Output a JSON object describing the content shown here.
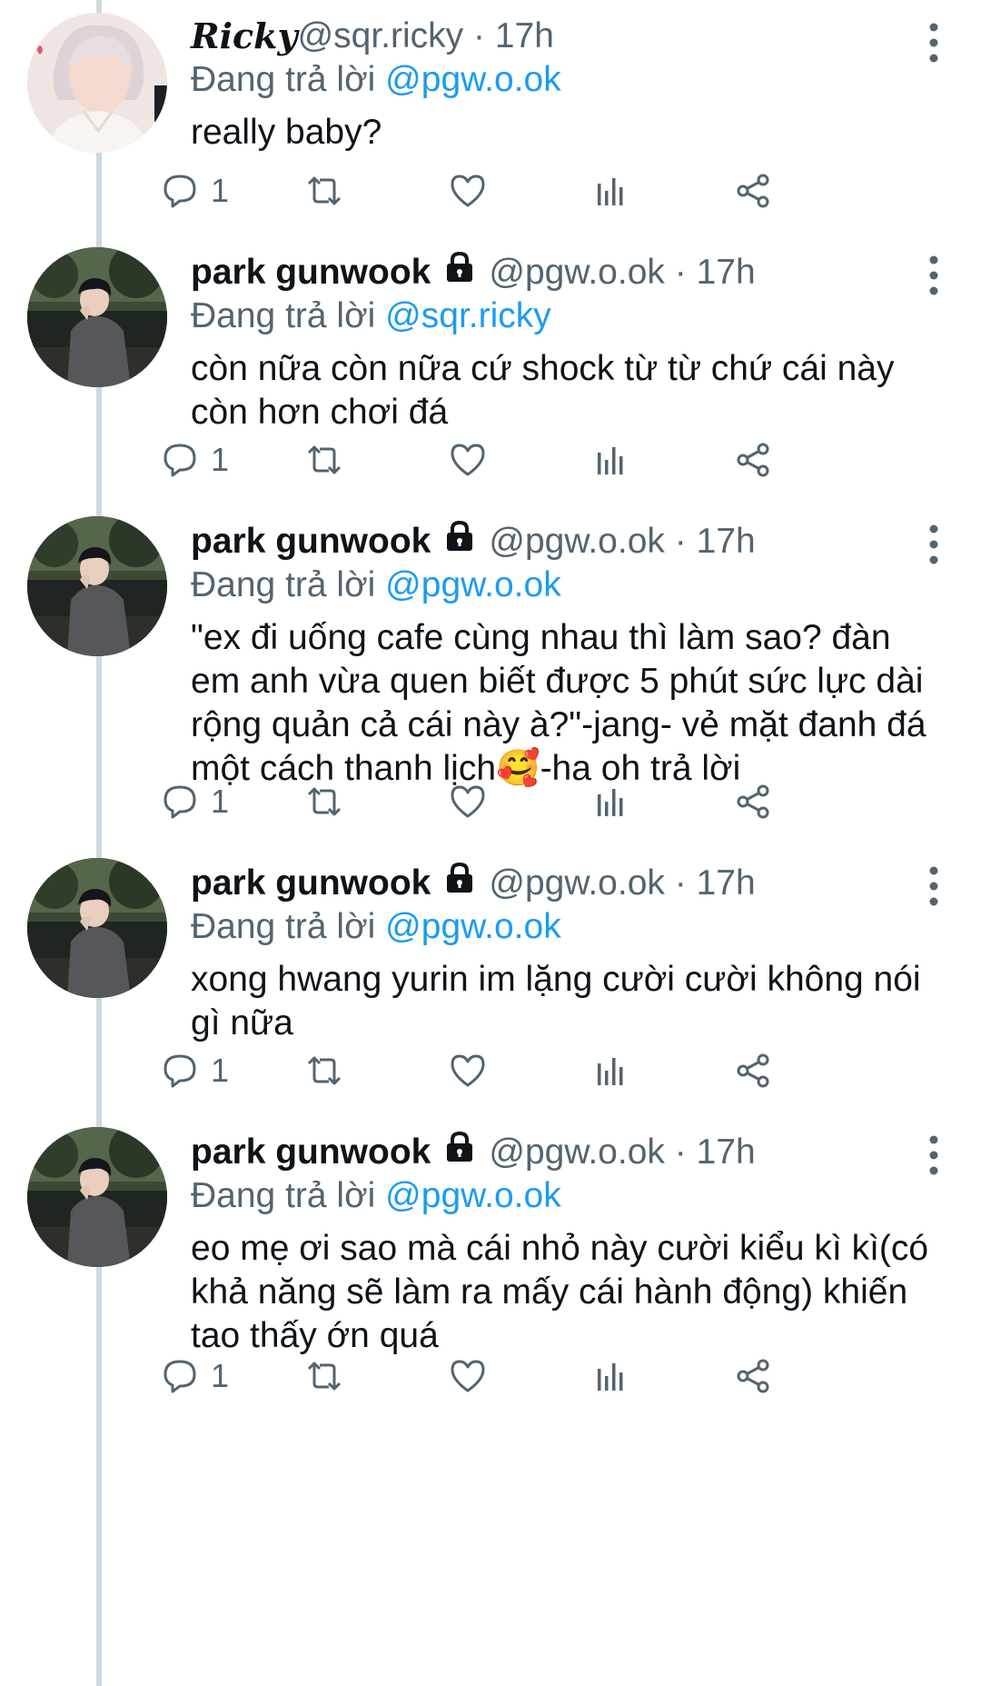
{
  "tweets": [
    {
      "display_name": "Ricky",
      "handle": "@sqr.ricky",
      "separator": " · ",
      "time": "17h",
      "locked": false,
      "reply_label": "Đang trả lời ",
      "reply_to": "@pgw.o.ok",
      "text": "really baby?",
      "reply_count": "1"
    },
    {
      "display_name": "park gunwook",
      "handle": "@pgw.o.ok",
      "separator": " · ",
      "time": "17h",
      "locked": true,
      "reply_label": "Đang trả lời ",
      "reply_to": "@sqr.ricky",
      "text": "còn nữa còn nữa cứ shock từ từ chứ cái này còn hơn chơi đá",
      "reply_count": "1"
    },
    {
      "display_name": "park gunwook",
      "handle": "@pgw.o.ok",
      "separator": " · ",
      "time": "17h",
      "locked": true,
      "reply_label": "Đang trả lời ",
      "reply_to": "@pgw.o.ok",
      "text": "\"ex đi uống cafe cùng nhau thì làm sao? đàn em anh vừa quen biết được 5 phút sức lực dài rộng quản cả cái này à?\"-jang- vẻ mặt đanh đá một cách thanh lịch🥰-ha oh trả lời",
      "reply_count": "1"
    },
    {
      "display_name": "park gunwook",
      "handle": "@pgw.o.ok",
      "separator": " · ",
      "time": "17h",
      "locked": true,
      "reply_label": "Đang trả lời ",
      "reply_to": "@pgw.o.ok",
      "text": "xong hwang yurin im lặng cười cười không nói gì nữa",
      "reply_count": "1"
    },
    {
      "display_name": "park gunwook",
      "handle": "@pgw.o.ok",
      "separator": " · ",
      "time": "17h",
      "locked": true,
      "reply_label": "Đang trả lời ",
      "reply_to": "@pgw.o.ok",
      "text": "eo mẹ ơi sao mà cái nhỏ này cười kiểu kì kì(có khả năng sẽ làm ra mấy cái hành động) khiến tao thấy ớn quá",
      "reply_count": "1"
    }
  ],
  "icons": {
    "reply": "reply-icon",
    "retweet": "retweet-icon",
    "like": "heart-icon",
    "views": "views-icon",
    "share": "share-icon",
    "more": "more-vertical-icon",
    "lock": "lock-icon"
  },
  "colors": {
    "mention": "#1d9bf0",
    "secondary_text": "#536471",
    "primary_text": "#0f1419",
    "thread_line": "#cfd9de"
  }
}
